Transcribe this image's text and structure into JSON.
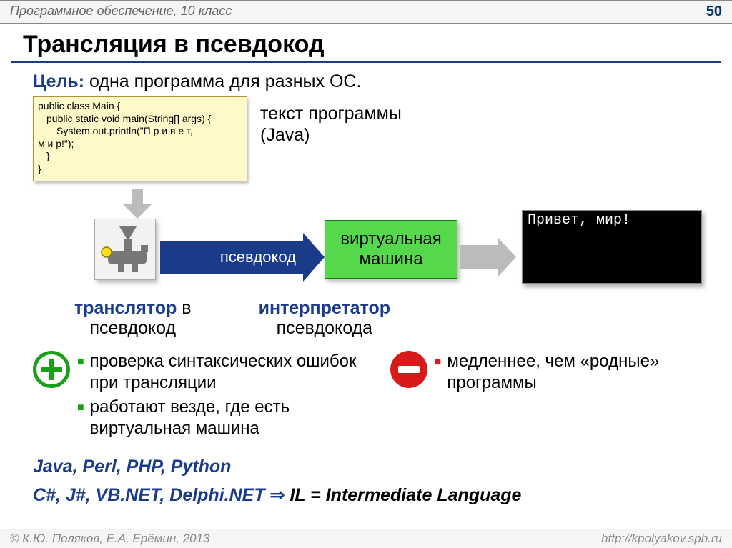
{
  "header": {
    "subject": "Программное обеспечение, 10 класс",
    "page": "50"
  },
  "title": "Трансляция в псевдокод",
  "goal": {
    "label": "Цель:",
    "text": "одна программа для разных ОС."
  },
  "code": {
    "l1": "public class Main {",
    "l2": "public static void main(String[] args) {",
    "l3": "System.out.println(\"П р и в е т,",
    "l4": "м и р!\");",
    "l5": "}",
    "l6": "}"
  },
  "java_label_line1": "текст программы",
  "java_label_line2": "(Java)",
  "flow": {
    "pseudocode_label": "псевдокод",
    "vm_label": "виртуальная машина",
    "terminal_output": "Привет, мир!"
  },
  "captions": {
    "col1_bold": "транслятор",
    "col1_rest": " в",
    "col1_sub": "псевдокод",
    "col2_bold": "интерпретатор",
    "col2_sub": "псевдокода"
  },
  "pros": {
    "item1": "проверка синтаксических ошибок при трансляции",
    "item2": "работают везде, где есть виртуальная машина"
  },
  "cons": {
    "item1": "медленнее, чем «родные» программы"
  },
  "langs": {
    "line1": "Java, Perl, PHP, Python",
    "line2_prefix": "C#, J#, VB.NET, Delphi.NET",
    "line2_arrow": " ⇒ ",
    "line2_il_b1": "I",
    "line2_il_r1": "L = ",
    "line2_il_b2": "I",
    "line2_il_r2": "ntermediate ",
    "line2_il_b3": "L",
    "line2_il_r3": "anguage"
  },
  "footer": {
    "copyright": "© К.Ю. Поляков, Е.А. Ерёмин, 2013",
    "url": "http://kpolyakov.spb.ru"
  }
}
